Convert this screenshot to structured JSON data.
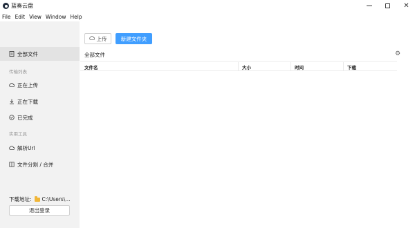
{
  "window": {
    "title": "蓝奏云盘",
    "controls": {
      "minimize": "minimize",
      "maximize": "maximize",
      "close": "✕"
    }
  },
  "menu": [
    "File",
    "Edit",
    "View",
    "Window",
    "Help"
  ],
  "sidebar": {
    "all_files": "全部文件",
    "section_transfer": "传输列表",
    "uploading": "正在上传",
    "downloading": "正在下载",
    "completed": "已完成",
    "section_tools": "实用工具",
    "parse_url": "解析Url",
    "split_merge": "文件分割 / 合并",
    "download_path_label": "下载地址:",
    "download_path_value": "C:\\Users\\...",
    "logout": "退出登录"
  },
  "toolbar": {
    "upload": "上传",
    "new_folder": "新建文件夹"
  },
  "breadcrumb": "全部文件",
  "table": {
    "columns": [
      "文件名",
      "大小",
      "时间",
      "下载"
    ],
    "rows": []
  },
  "colors": {
    "accent": "#409eff",
    "sidebar_bg": "#f2f2f2",
    "active_bg": "#e3e3e3",
    "folder": "#f0b537"
  }
}
